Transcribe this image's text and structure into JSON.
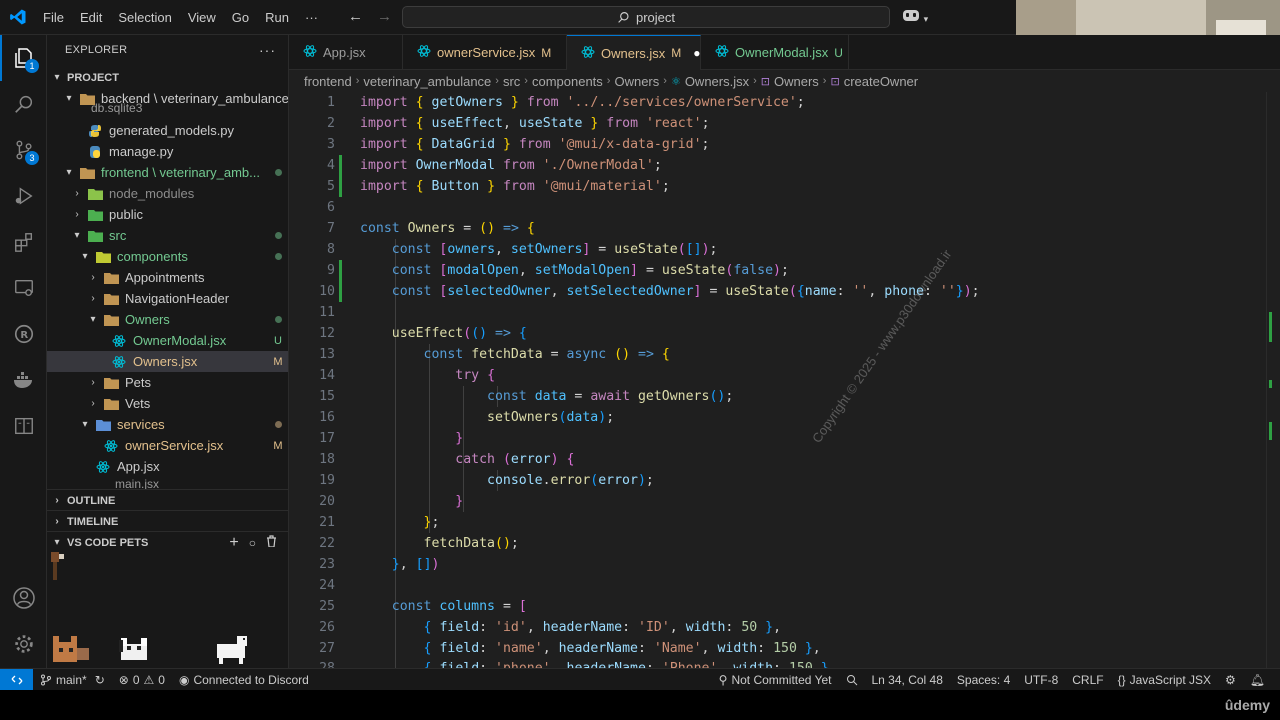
{
  "titlebar": {
    "menu": [
      "File",
      "Edit",
      "Selection",
      "View",
      "Go",
      "Run",
      "···"
    ],
    "search": "project"
  },
  "activity": {
    "explorer_badge": "1",
    "scm_badge": "3"
  },
  "explorer": {
    "title": "EXPLORER",
    "project": "PROJECT",
    "rows": [
      {
        "label": "backend \\ veterinary_ambulance",
        "status": ""
      },
      {
        "label": "db.sqlite3",
        "status": ""
      },
      {
        "label": "generated_models.py",
        "status": ""
      },
      {
        "label": "manage.py",
        "status": ""
      },
      {
        "label": "frontend \\ veterinary_amb...",
        "status": ""
      },
      {
        "label": "node_modules",
        "status": ""
      },
      {
        "label": "public",
        "status": ""
      },
      {
        "label": "src",
        "status": ""
      },
      {
        "label": "components",
        "status": ""
      },
      {
        "label": "Appointments",
        "status": ""
      },
      {
        "label": "NavigationHeader",
        "status": ""
      },
      {
        "label": "Owners",
        "status": ""
      },
      {
        "label": "OwnerModal.jsx",
        "status": "U"
      },
      {
        "label": "Owners.jsx",
        "status": "M"
      },
      {
        "label": "Pets",
        "status": ""
      },
      {
        "label": "Vets",
        "status": ""
      },
      {
        "label": "services",
        "status": ""
      },
      {
        "label": "ownerService.jsx",
        "status": "M"
      },
      {
        "label": "App.jsx",
        "status": ""
      },
      {
        "label": "main.jsx",
        "status": ""
      }
    ],
    "outline": "OUTLINE",
    "timeline": "TIMELINE",
    "pets": "VS CODE PETS"
  },
  "tabs": [
    {
      "label": "App.jsx",
      "status": ""
    },
    {
      "label": "ownerService.jsx",
      "status": "M"
    },
    {
      "label": "Owners.jsx",
      "status": "M"
    },
    {
      "label": "OwnerModal.jsx",
      "status": "U"
    }
  ],
  "breadcrumb": [
    "frontend",
    "veterinary_ambulance",
    "src",
    "components",
    "Owners",
    "Owners.jsx",
    "Owners",
    "createOwner"
  ],
  "line_numbers": [
    "1",
    "2",
    "3",
    "4",
    "5",
    "6",
    "7",
    "8",
    "9",
    "10",
    "11",
    "12",
    "13",
    "14",
    "15",
    "16",
    "17",
    "18",
    "19",
    "20",
    "21",
    "22",
    "23",
    "24",
    "25",
    "26",
    "27",
    "28"
  ],
  "watermark": "Copyright © 2025 - www.p30download.ir",
  "status": {
    "branch": "main*",
    "errors": "0",
    "warnings": "0",
    "discord": "Connected to Discord",
    "not_committed": "Not Committed Yet",
    "position": "Ln 34, Col 48",
    "spaces": "Spaces: 4",
    "encoding": "UTF-8",
    "eol": "CRLF",
    "language": "JavaScript JSX"
  },
  "udemy": "ûdemy"
}
